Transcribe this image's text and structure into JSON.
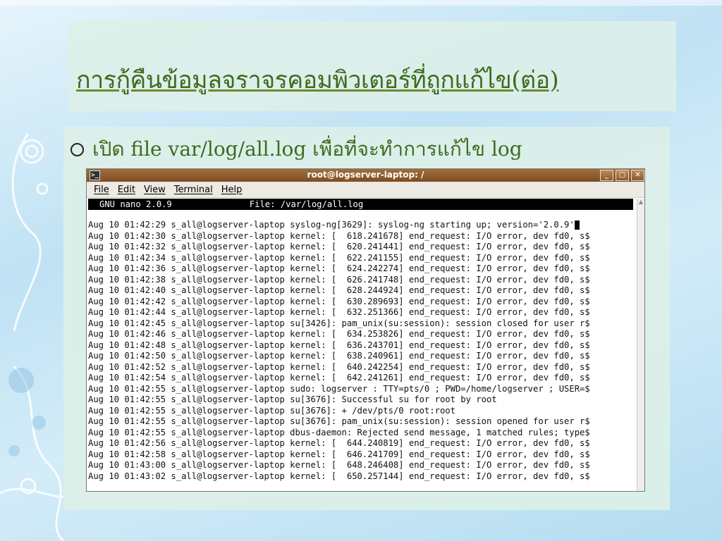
{
  "slide": {
    "title": "การกู้คืนข้อมูลจราจรคอมพิวเตอร์ที่ถูกแก้ไข(ต่อ)",
    "bullet": "เปิด file var/log/all.log เพื่อที่จะทำการแก้ไข log"
  },
  "window": {
    "title": "root@logserver-laptop: /",
    "icons": [
      "terminal-icon",
      "minimize-icon",
      "maximize-icon",
      "close-icon"
    ]
  },
  "menu": {
    "items": [
      "File",
      "Edit",
      "View",
      "Terminal",
      "Help"
    ]
  },
  "nano": {
    "header": "GNU nano 2.0.9               File: /var/log/all.log"
  },
  "log": [
    "Aug 10 01:42:29 s_all@logserver-laptop syslog-ng[3629]: syslog-ng starting up; version='2.0.9'",
    "Aug 10 01:42:30 s_all@logserver-laptop kernel: [  618.241678] end_request: I/O error, dev fd0, s$",
    "Aug 10 01:42:32 s_all@logserver-laptop kernel: [  620.241441] end_request: I/O error, dev fd0, s$",
    "Aug 10 01:42:34 s_all@logserver-laptop kernel: [  622.241155] end_request: I/O error, dev fd0, s$",
    "Aug 10 01:42:36 s_all@logserver-laptop kernel: [  624.242274] end_request: I/O error, dev fd0, s$",
    "Aug 10 01:42:38 s_all@logserver-laptop kernel: [  626.241748] end_request: I/O error, dev fd0, s$",
    "Aug 10 01:42:40 s_all@logserver-laptop kernel: [  628.244924] end_request: I/O error, dev fd0, s$",
    "Aug 10 01:42:42 s_all@logserver-laptop kernel: [  630.289693] end_request: I/O error, dev fd0, s$",
    "Aug 10 01:42:44 s_all@logserver-laptop kernel: [  632.251366] end_request: I/O error, dev fd0, s$",
    "Aug 10 01:42:45 s_all@logserver-laptop su[3426]: pam_unix(su:session): session closed for user r$",
    "Aug 10 01:42:46 s_all@logserver-laptop kernel: [  634.253826] end_request: I/O error, dev fd0, s$",
    "Aug 10 01:42:48 s_all@logserver-laptop kernel: [  636.243701] end_request: I/O error, dev fd0, s$",
    "Aug 10 01:42:50 s_all@logserver-laptop kernel: [  638.240961] end_request: I/O error, dev fd0, s$",
    "Aug 10 01:42:52 s_all@logserver-laptop kernel: [  640.242254] end_request: I/O error, dev fd0, s$",
    "Aug 10 01:42:54 s_all@logserver-laptop kernel: [  642.241261] end_request: I/O error, dev fd0, s$",
    "Aug 10 01:42:55 s_all@logserver-laptop sudo: logserver : TTY=pts/0 ; PWD=/home/logserver ; USER=$",
    "Aug 10 01:42:55 s_all@logserver-laptop su[3676]: Successful su for root by root",
    "Aug 10 01:42:55 s_all@logserver-laptop su[3676]: + /dev/pts/0 root:root",
    "Aug 10 01:42:55 s_all@logserver-laptop su[3676]: pam_unix(su:session): session opened for user r$",
    "Aug 10 01:42:55 s_all@logserver-laptop dbus-daemon: Rejected send message, 1 matched rules; type$",
    "Aug 10 01:42:56 s_all@logserver-laptop kernel: [  644.240819] end_request: I/O error, dev fd0, s$",
    "Aug 10 01:42:58 s_all@logserver-laptop kernel: [  646.241709] end_request: I/O error, dev fd0, s$",
    "Aug 10 01:43:00 s_all@logserver-laptop kernel: [  648.246408] end_request: I/O error, dev fd0, s$",
    "Aug 10 01:43:02 s_all@logserver-laptop kernel: [  650.257144] end_request: I/O error, dev fd0, s$"
  ],
  "colors": {
    "title_text": "#3f6b1f",
    "titlebar": "#8a5a2c",
    "slide_panel": "#dcefe9"
  }
}
